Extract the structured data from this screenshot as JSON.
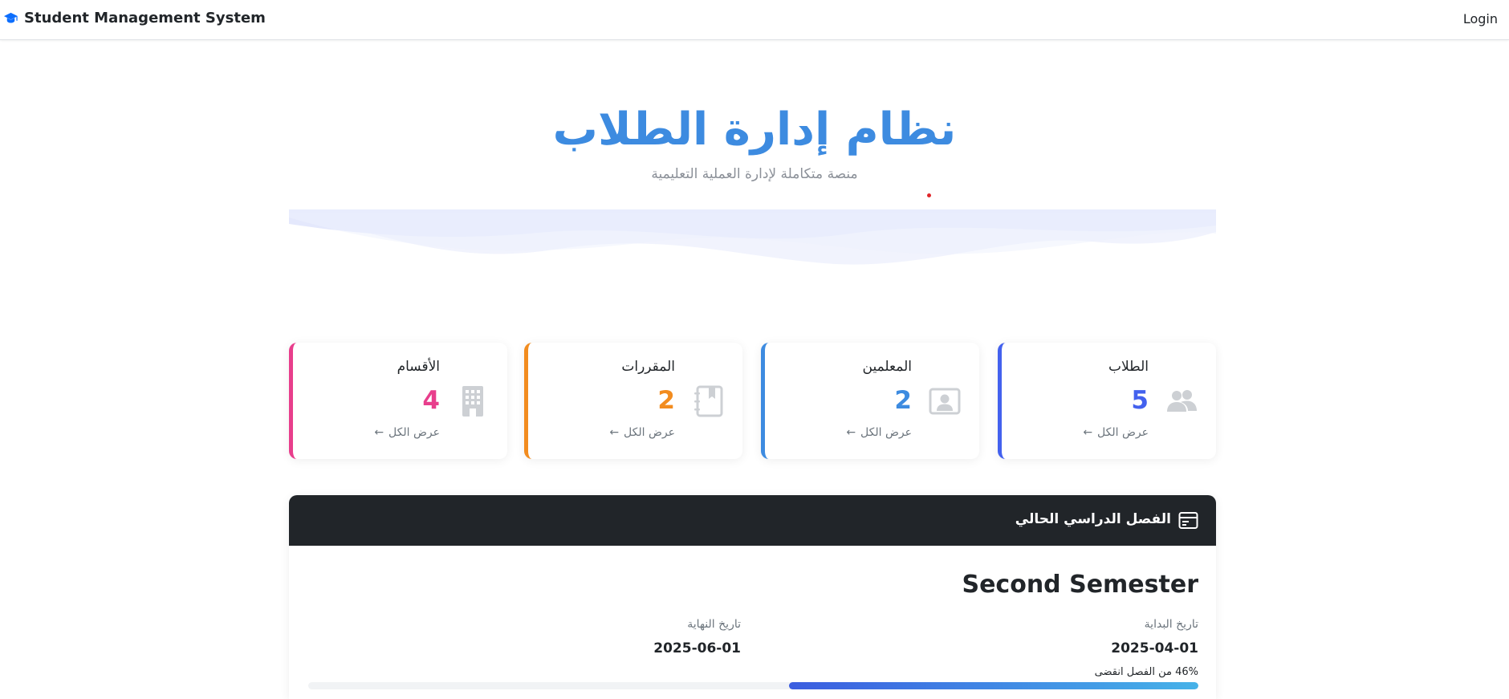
{
  "navbar": {
    "brand": "Student Management System",
    "brand_icon": "graduation-cap-icon",
    "login": "Login"
  },
  "hero": {
    "title": "نظام إدارة الطلاب",
    "subtitle": "منصة متكاملة لإدارة العملية التعليمية"
  },
  "stats": [
    {
      "title": "الطلاب",
      "count": "5",
      "link": "عرض الكل",
      "icon": "users-icon",
      "color": "#4361ee"
    },
    {
      "title": "المعلمين",
      "count": "2",
      "link": "عرض الكل",
      "icon": "teacher-badge-icon",
      "color": "#3d8be0"
    },
    {
      "title": "المقررات",
      "count": "2",
      "link": "عرض الكل",
      "icon": "journal-bookmark-icon",
      "color": "#f28c1f"
    },
    {
      "title": "الأقسام",
      "count": "4",
      "link": "عرض الكل",
      "icon": "building-icon",
      "color": "#e83e8c"
    }
  ],
  "semester": {
    "header": "الفصل الدراسي الحالي",
    "header_icon": "calendar-card-icon",
    "name": "Second Semester",
    "start_label": "تاريخ البداية",
    "start_date": "2025-04-01",
    "end_label": "تاريخ النهاية",
    "end_date": "2025-06-01",
    "progress_text": "46% من الفصل انقضى",
    "progress_percent": 46
  }
}
